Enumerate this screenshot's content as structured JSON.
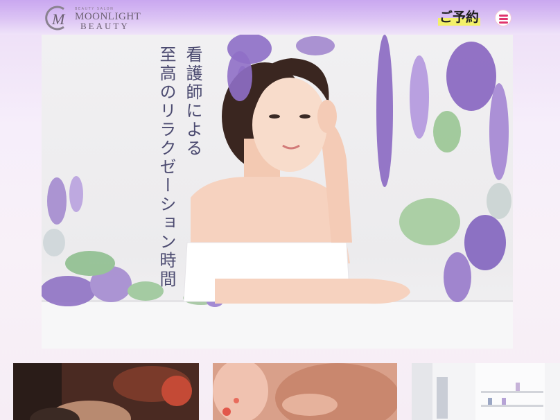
{
  "header": {
    "logo": {
      "mark": "M",
      "small": "BEAUTY SALON",
      "line1": "MOONLIGHT",
      "line2": "BEAUTY"
    },
    "reserve_label": "ご予約",
    "menu_icon": "hamburger-menu-icon"
  },
  "hero": {
    "catch_line1": "看護師による",
    "catch_line2": "至高のリラクゼーション時間",
    "image_subject": "woman-with-wisteria-photo"
  },
  "cards": [
    {
      "image": "face-massage-photo"
    },
    {
      "image": "back-massage-photo"
    },
    {
      "image": "salon-interior-photo"
    }
  ],
  "colors": {
    "header_purple": "#c9a7f0",
    "menu_accent": "#e0356d",
    "catch_text": "#4b4a70",
    "reserve_highlight": "#f3f06a"
  }
}
